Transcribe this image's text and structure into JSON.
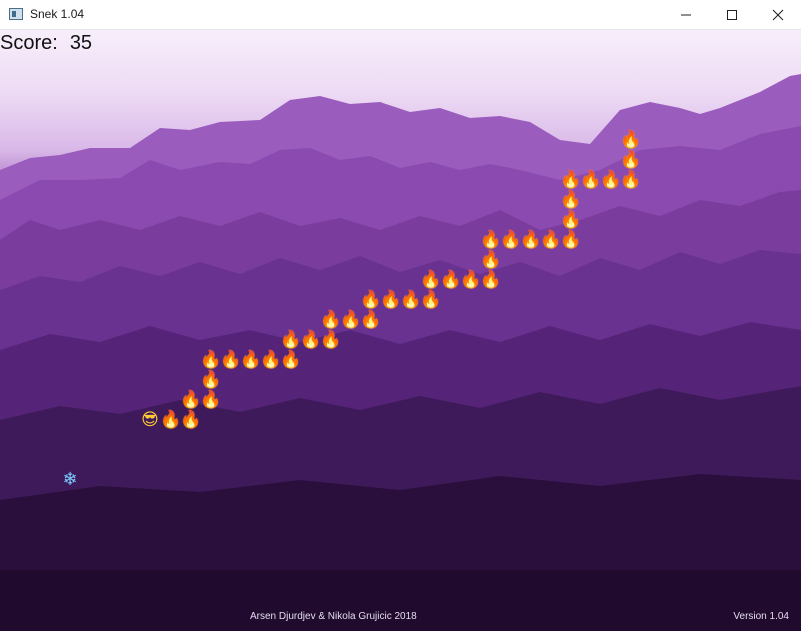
{
  "window": {
    "title": "Snek 1.04",
    "icons": [
      "app-icon",
      "minimize-icon",
      "maximize-icon",
      "close-icon"
    ]
  },
  "hud": {
    "score_label": "Score:",
    "score_value": "35"
  },
  "footer": {
    "credits": "Arsen Djurdjev & Nikola Grujicic 2018",
    "version": "Version 1.04"
  },
  "board": {
    "cell_glyph": "🔥",
    "head_glyph": "😎",
    "food_glyph": "❄",
    "head": [
      7,
      19
    ],
    "food": [
      3,
      22
    ],
    "snake_cells": [
      [
        8,
        19
      ],
      [
        9,
        19
      ],
      [
        9,
        18
      ],
      [
        10,
        18
      ],
      [
        10,
        17
      ],
      [
        10,
        16
      ],
      [
        11,
        16
      ],
      [
        12,
        16
      ],
      [
        13,
        16
      ],
      [
        14,
        16
      ],
      [
        14,
        15
      ],
      [
        15,
        15
      ],
      [
        16,
        15
      ],
      [
        16,
        14
      ],
      [
        17,
        14
      ],
      [
        18,
        14
      ],
      [
        18,
        13
      ],
      [
        19,
        13
      ],
      [
        20,
        13
      ],
      [
        21,
        13
      ],
      [
        21,
        12
      ],
      [
        22,
        12
      ],
      [
        23,
        12
      ],
      [
        24,
        12
      ],
      [
        24,
        11
      ],
      [
        24,
        10
      ],
      [
        25,
        10
      ],
      [
        26,
        10
      ],
      [
        27,
        10
      ],
      [
        28,
        10
      ],
      [
        28,
        9
      ],
      [
        28,
        8
      ],
      [
        28,
        7
      ],
      [
        29,
        7
      ],
      [
        30,
        7
      ],
      [
        31,
        7
      ],
      [
        31,
        6
      ],
      [
        31,
        5
      ]
    ]
  },
  "colors": {
    "sky_top": "#f7eefb",
    "mountain_purple": "#8e4fb0",
    "ground_dark": "#1c0a28"
  }
}
